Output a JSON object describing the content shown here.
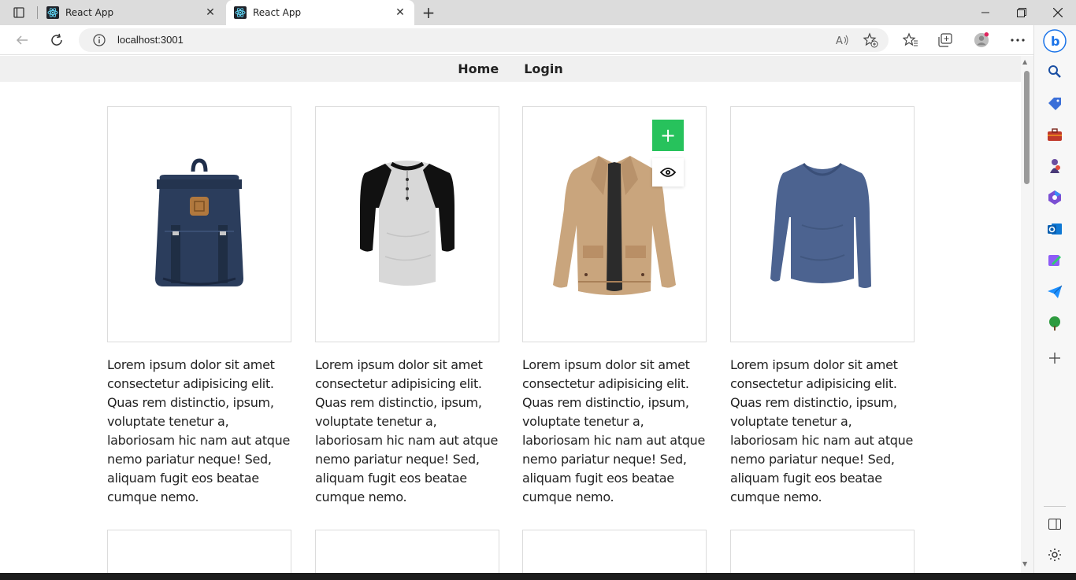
{
  "browser": {
    "tabs": [
      {
        "title": "React App",
        "active": false
      },
      {
        "title": "React App",
        "active": true
      }
    ],
    "url": "localhost:3001"
  },
  "nav": {
    "links": [
      "Home",
      "Login"
    ]
  },
  "products": [
    {
      "image": "backpack",
      "description": "Lorem ipsum dolor sit amet consectetur adipisicing elit. Quas rem distinctio, ipsum, voluptate tenetur a, laboriosam hic nam aut atque nemo pariatur neque! Sed, aliquam fugit eos beatae cumque nemo."
    },
    {
      "image": "raglan-tee",
      "description": "Lorem ipsum dolor sit amet consectetur adipisicing elit. Quas rem distinctio, ipsum, voluptate tenetur a, laboriosam hic nam aut atque nemo pariatur neque! Sed, aliquam fugit eos beatae cumque nemo."
    },
    {
      "image": "jacket",
      "description": "Lorem ipsum dolor sit amet consectetur adipisicing elit. Quas rem distinctio, ipsum, voluptate tenetur a, laboriosam hic nam aut atque nemo pariatur neque! Sed, aliquam fugit eos beatae cumque nemo."
    },
    {
      "image": "long-sleeve-shirt",
      "description": "Lorem ipsum dolor sit amet consectetur adipisicing elit. Quas rem distinctio, ipsum, voluptate tenetur a, laboriosam hic nam aut atque nemo pariatur neque! Sed, aliquam fugit eos beatae cumque nemo."
    }
  ],
  "hover_actions": {
    "add_label": "+"
  },
  "colors": {
    "add_button": "#27c25c",
    "nav_bg": "#f0f0f0"
  }
}
